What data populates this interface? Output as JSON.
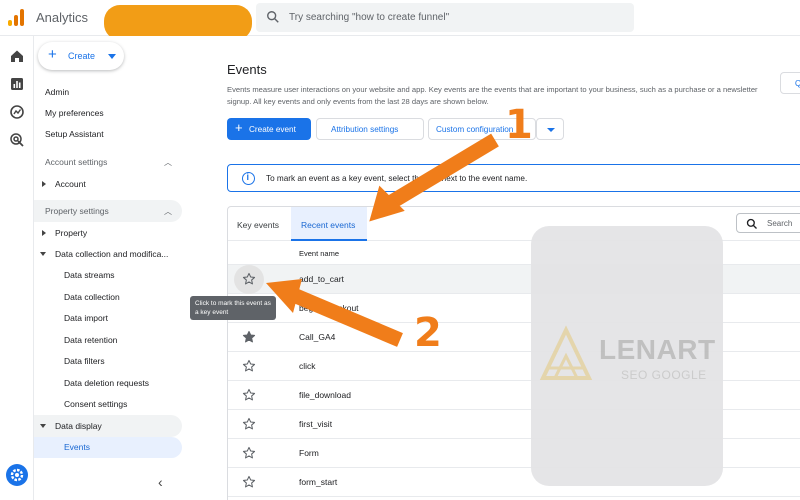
{
  "header": {
    "app_title": "Analytics",
    "search_placeholder": "Try searching \"how to create funnel\""
  },
  "sidebar": {
    "create_label": "Create",
    "items": [
      {
        "label": "Admin"
      },
      {
        "label": "My preferences"
      },
      {
        "label": "Setup Assistant"
      }
    ],
    "account_settings": {
      "label": "Account settings",
      "items": [
        {
          "label": "Account"
        }
      ]
    },
    "property_settings": {
      "label": "Property settings",
      "items": [
        {
          "label": "Property"
        },
        {
          "label": "Data collection and modifica..."
        },
        {
          "label": "Data streams"
        },
        {
          "label": "Data collection"
        },
        {
          "label": "Data import"
        },
        {
          "label": "Data retention"
        },
        {
          "label": "Data filters"
        },
        {
          "label": "Data deletion requests"
        },
        {
          "label": "Consent settings"
        }
      ]
    },
    "data_display": {
      "label": "Data display",
      "items": [
        {
          "label": "Events"
        }
      ]
    }
  },
  "main": {
    "title": "Events",
    "description": "Events measure user interactions on your website and app. Key events are the events that are important to your business, such as a purchase or a newsletter signup. All key events and only events from the last 28 days are shown below.",
    "q_button": "Q",
    "buttons": {
      "create_event": "Create event",
      "attribution_settings": "Attribution settings",
      "custom_configuration": "Custom configuration"
    },
    "banner_text": "To mark an event as a key event, select the star next to the event name.",
    "tabs": [
      {
        "label": "Key events"
      },
      {
        "label": "Recent events"
      }
    ],
    "search_label": "Search",
    "column_header": "Event name",
    "events": [
      {
        "name": "add_to_cart",
        "starred": false
      },
      {
        "name": "begin_checkout",
        "starred": false
      },
      {
        "name": "Call_GA4",
        "starred": true
      },
      {
        "name": "click",
        "starred": false
      },
      {
        "name": "file_download",
        "starred": false
      },
      {
        "name": "first_visit",
        "starred": false
      },
      {
        "name": "Form",
        "starred": false
      },
      {
        "name": "form_start",
        "starred": false
      }
    ],
    "tooltip": "Click to mark this event as a key event"
  },
  "annotations": {
    "step1": "1",
    "step2": "2",
    "arrow_color": "#f07d1a"
  },
  "watermark": {
    "brand": "LENART",
    "subtitle": "SEO GOOGLE"
  },
  "colors": {
    "primary": "#1a73e8",
    "account_mask": "#f29d16"
  }
}
